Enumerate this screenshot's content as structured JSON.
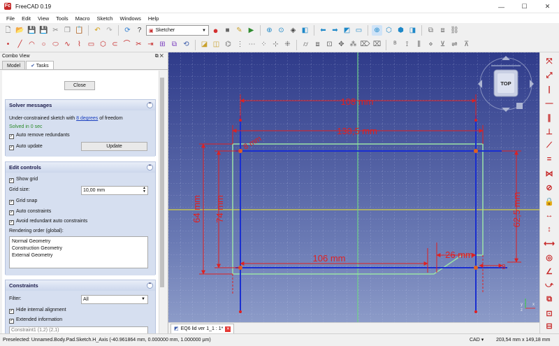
{
  "window": {
    "title": "FreeCAD 0.19",
    "app_icon": "Fc",
    "minimize": "—",
    "maximize": "☐",
    "close": "✕"
  },
  "menu": [
    "File",
    "Edit",
    "View",
    "Tools",
    "Macro",
    "Sketch",
    "Windows",
    "Help"
  ],
  "toolbar": {
    "workbench": "Sketcher"
  },
  "combo_view": {
    "title": "Combo View",
    "tabs": [
      "Model",
      "Tasks"
    ],
    "active_tab": "Tasks",
    "close_button": "Close"
  },
  "solver": {
    "title": "Solver messages",
    "msg_prefix": "Under-constrained sketch with ",
    "msg_link": "8 degrees",
    "msg_suffix": " of freedom",
    "solved": "Solved in 0 sec",
    "auto_remove": "Auto remove redundants",
    "auto_update": "Auto update",
    "update_button": "Update"
  },
  "edit_controls": {
    "title": "Edit controls",
    "show_grid": "Show grid",
    "grid_size_label": "Grid size:",
    "grid_size_value": "10,00 mm",
    "grid_snap": "Grid snap",
    "auto_constraints": "Auto constraints",
    "avoid_redundant": "Avoid redundant auto constraints",
    "rendering_order_label": "Rendering order (global):",
    "rendering_order": [
      "Normal Geometry",
      "Construction Geometry",
      "External Geometry"
    ]
  },
  "constraints": {
    "title": "Constraints",
    "filter_label": "Filter:",
    "filter_value": "All",
    "hide_internal": "Hide internal alignment",
    "extended_info": "Extended information",
    "partial_row": "Constraint1 (1,2) (2,1)"
  },
  "viewport": {
    "navcube_face": "TOP",
    "dimensions": {
      "d108": "108 mm",
      "d138": "138,5 mm",
      "d64": "64 mm",
      "d74": "74 mm",
      "d625": "62,5 mm",
      "d106": "106 mm",
      "d26": "26 mm",
      "d8": "8 mm",
      "small": "8"
    },
    "axis_x": "x",
    "axis_y": "y",
    "axis_z": "z",
    "colors": {
      "geometry": "#1a2fd0",
      "constraint": "#e02020",
      "construction": "#9be3a7",
      "axis_h": "#d8d040",
      "grid": "#c8d0ee"
    }
  },
  "doc_tab": {
    "label": "EQ6 lid ver 1_1 : 1*",
    "close": "✕"
  },
  "status": {
    "preselected": "Preselected: Unnamed.Body.Pad.Sketch.H_Axis (-40.961864 mm, 0.000000 mm, 1.000000 µm)",
    "nav_style": "CAD ▾",
    "dimensions": "203,54 mm x 149,18 mm"
  }
}
